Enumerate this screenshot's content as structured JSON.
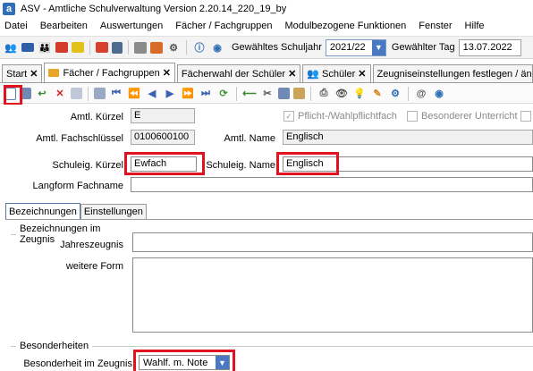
{
  "window": {
    "title": "ASV - Amtliche Schulverwaltung Version 2.20.14_220_19_by",
    "app_icon": "a"
  },
  "menu": [
    "Datei",
    "Bearbeiten",
    "Auswertungen",
    "Fächer / Fachgruppen",
    "Modulbezogene Funktionen",
    "Fenster",
    "Hilfe"
  ],
  "toolbar": {
    "schuljahr_label": "Gewähltes Schuljahr",
    "schuljahr_value": "2021/22",
    "tag_label": "Gewählter Tag",
    "tag_value": "13.07.2022"
  },
  "tabs": [
    {
      "label": "Start",
      "closable": true
    },
    {
      "label": "Fächer / Fachgruppen",
      "closable": true,
      "active": true
    },
    {
      "label": "Fächerwahl der Schüler",
      "closable": true
    },
    {
      "label": "Schüler",
      "closable": true
    },
    {
      "label": "Zeugniseinstellungen festlegen / ändern",
      "closable": false
    }
  ],
  "form": {
    "amtl_kuerzel_label": "Amtl. Kürzel",
    "amtl_kuerzel_value": "E",
    "pflicht_label": "Pflicht-/Wahlpflichtfach",
    "besonderer_unterricht_label": "Besonderer Unterricht",
    "amtl_fachschluessel_label": "Amtl.  Fachschlüssel",
    "amtl_fachschluessel_value": "0100600100",
    "amtl_name_label": "Amtl. Name",
    "amtl_name_value": "Englisch",
    "schuleig_kuerzel_label": "Schuleig. Kürzel",
    "schuleig_kuerzel_value": "Ewfach",
    "schuleig_name_label": "Schuleig. Name",
    "schuleig_name_value": "Englisch",
    "langform_label": "Langform Fachname",
    "langform_value": ""
  },
  "subtabs": [
    "Bezeichnungen",
    "Einstellungen"
  ],
  "zeugnis": {
    "group_label": "Bezeichnungen im Zeugnis",
    "jahreszeugnis_label": "Jahreszeugnis",
    "weitere_form_label": "weitere Form"
  },
  "besonderheiten": {
    "group_label": "Besonderheiten",
    "zeugnis_label": "Besonderheit im Zeugnis",
    "zeugnis_value": "Wahlf. m. Note"
  },
  "colors": {
    "highlight": "#e2121e",
    "combo_button": "#4a78c2",
    "tab_folder": "#e9a52b"
  }
}
